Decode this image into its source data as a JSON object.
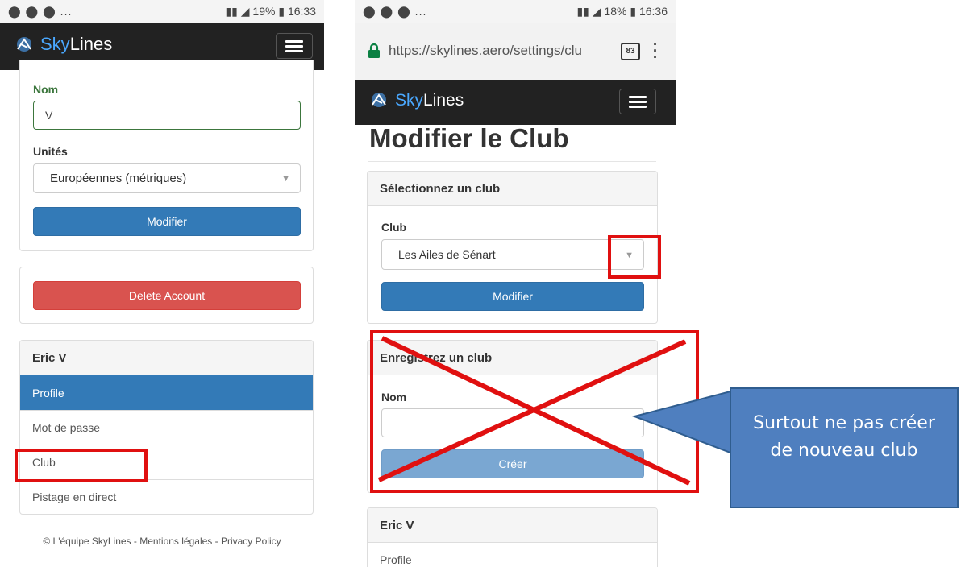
{
  "left_screen": {
    "status_bar": {
      "icons_left": "⬤ ⬤ ⬤ ...",
      "battery": "19%",
      "time": "16:33"
    },
    "navbar": {
      "brand_sky": "Sky",
      "brand_lines": "Lines"
    },
    "form": {
      "nom_label": "Nom",
      "nom_value": "V",
      "units_label": "Unités",
      "units_value": "Européennes (métriques)",
      "submit_label": "Modifier"
    },
    "delete_panel": {
      "button_label": "Delete Account"
    },
    "menu": {
      "title": "Eric V",
      "items": [
        "Profile",
        "Mot de passe",
        "Club",
        "Pistage en direct"
      ]
    },
    "footer": "© L'équipe SkyLines - Mentions légales - Privacy Policy"
  },
  "right_screen": {
    "status_bar": {
      "icons_left": "⬤ ⬤ ⬤ ...",
      "battery": "18%",
      "time": "16:36"
    },
    "url_bar": {
      "url": "https://skylines.aero/settings/clu",
      "tab_count": "83"
    },
    "navbar": {
      "brand_sky": "Sky",
      "brand_lines": "Lines"
    },
    "page_title": "Modifier le Club",
    "select_panel": {
      "heading": "Sélectionnez un club",
      "club_label": "Club",
      "club_value": "Les Ailes de Sénart",
      "submit_label": "Modifier"
    },
    "register_panel": {
      "heading": "Enregistrez un club",
      "nom_label": "Nom",
      "nom_value": "",
      "submit_label": "Créer"
    },
    "menu": {
      "title": "Eric V",
      "first_item": "Profile"
    }
  },
  "callout": {
    "text": "Surtout ne pas créer de nouveau club"
  },
  "colors": {
    "annotation_red": "#e01010",
    "primary_blue": "#337ab7",
    "callout_blue": "#4f7fbf"
  }
}
